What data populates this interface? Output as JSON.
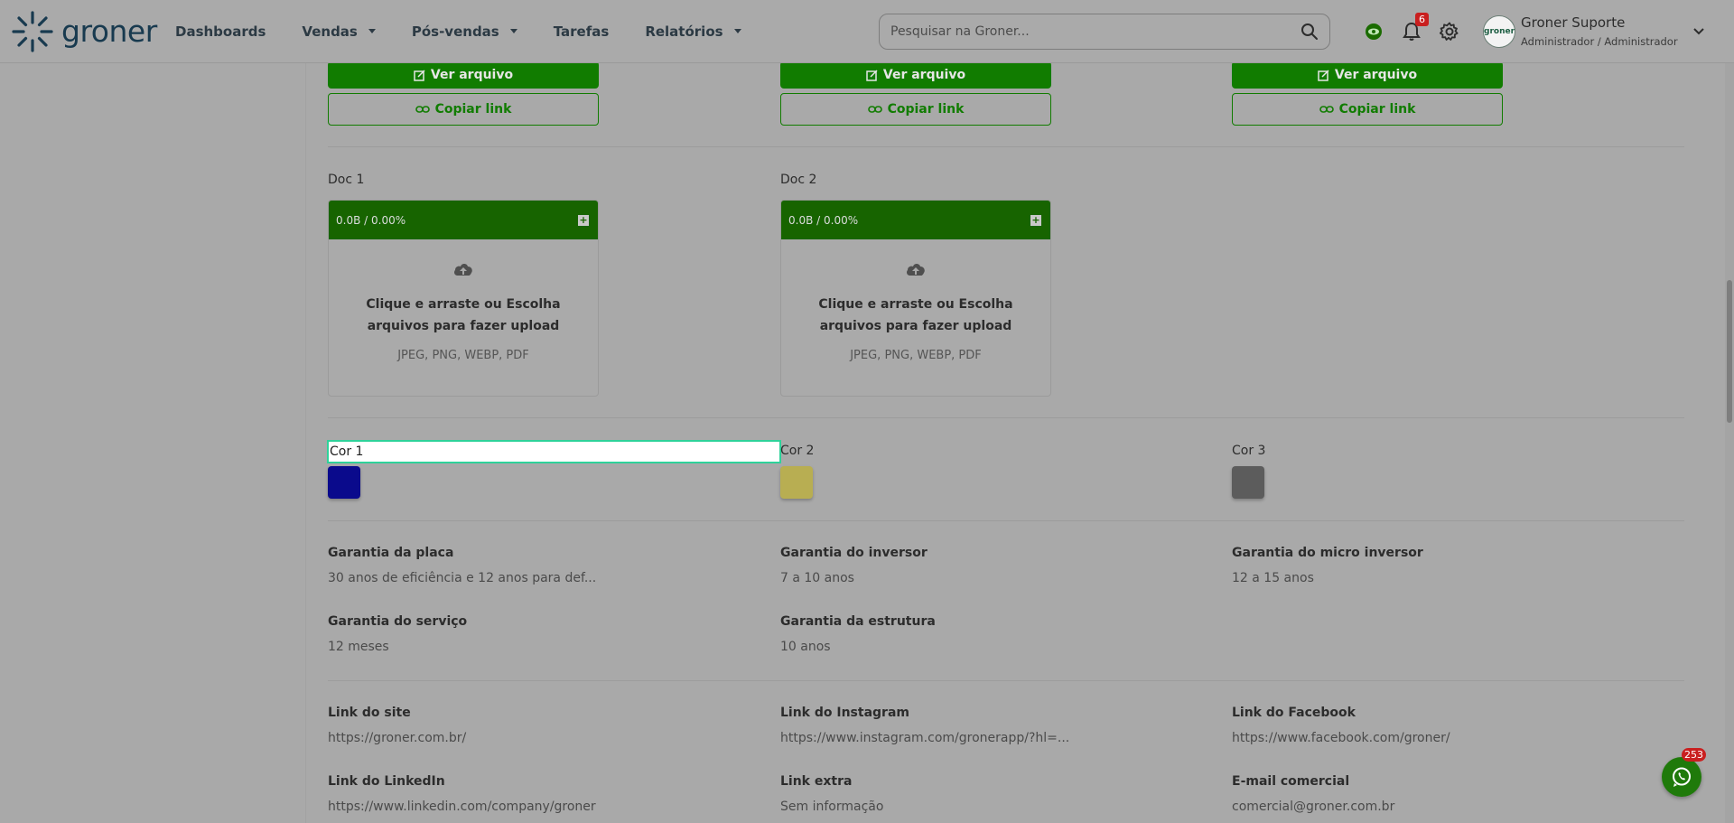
{
  "brand": {
    "name": "groner"
  },
  "nav": [
    {
      "label": "Dashboards",
      "has_caret": false
    },
    {
      "label": "Vendas",
      "has_caret": true
    },
    {
      "label": "Pós-vendas",
      "has_caret": true
    },
    {
      "label": "Tarefas",
      "has_caret": false
    },
    {
      "label": "Relatórios",
      "has_caret": true
    }
  ],
  "search": {
    "placeholder": "Pesquisar na Groner..."
  },
  "notifications": {
    "count": "6"
  },
  "user": {
    "name": "Groner Suporte",
    "role": "Administrador / Administrador",
    "avatar_text": "groner"
  },
  "files": {
    "view_label": "Ver arquivo",
    "copy_label": "Copiar link"
  },
  "docs": [
    {
      "label": "Doc 1",
      "progress": "0.0B / 0.00%",
      "upload_text_1": "Clique e arraste ou Escolha",
      "upload_text_2": "arquivos para fazer upload",
      "types": "JPEG, PNG, WEBP, PDF"
    },
    {
      "label": "Doc 2",
      "progress": "0.0B / 0.00%",
      "upload_text_1": "Clique e arraste ou Escolha",
      "upload_text_2": "arquivos para fazer upload",
      "types": "JPEG, PNG, WEBP, PDF"
    }
  ],
  "colors": [
    {
      "label": "Cor 1",
      "hex": "#0a0a8c"
    },
    {
      "label": "Cor 2",
      "hex": "#b8ae52"
    },
    {
      "label": "Cor 3",
      "hex": "#5c5c5c"
    }
  ],
  "warranties": {
    "placa": {
      "label": "Garantia da placa",
      "value": "30 anos de eficiência e 12 anos para def..."
    },
    "inversor": {
      "label": "Garantia do inversor",
      "value": "7 a 10 anos"
    },
    "micro": {
      "label": "Garantia do micro inversor",
      "value": "12 a 15 anos"
    },
    "servico": {
      "label": "Garantia do serviço",
      "value": "12 meses"
    },
    "estrutura": {
      "label": "Garantia da estrutura",
      "value": "10 anos"
    }
  },
  "links": {
    "site": {
      "label": "Link do site",
      "value": "https://groner.com.br/"
    },
    "instagram": {
      "label": "Link do Instagram",
      "value": "https://www.instagram.com/gronerapp/?hl=..."
    },
    "facebook": {
      "label": "Link do Facebook",
      "value": "https://www.facebook.com/groner/"
    },
    "linkedin": {
      "label": "Link do LinkedIn",
      "value": "https://www.linkedin.com/company/groner"
    },
    "extra": {
      "label": "Link extra",
      "value": "Sem informação"
    },
    "email": {
      "label": "E-mail comercial",
      "value": "comercial@groner.com.br"
    }
  },
  "whatsapp": {
    "badge": "253"
  },
  "theme": {
    "accent": "#117c00",
    "focus": "#2fd29a",
    "badge": "#c91f1f"
  }
}
